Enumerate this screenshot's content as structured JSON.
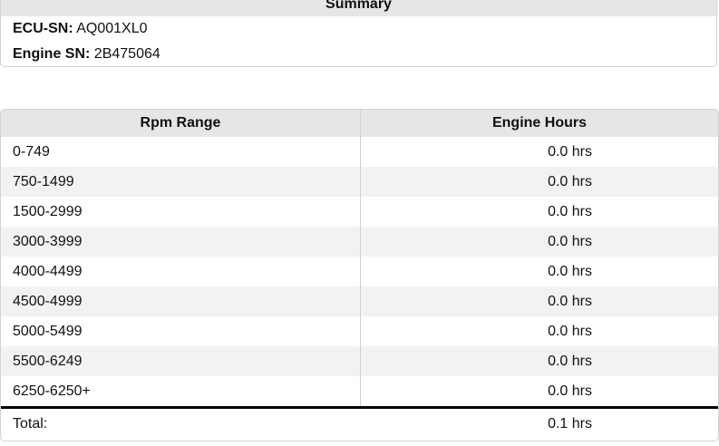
{
  "summary": {
    "title": "Summary",
    "ecu_sn_label": "ECU-SN:",
    "ecu_sn_value": "AQ001XL0",
    "engine_sn_label": "Engine SN:",
    "engine_sn_value": "2B475064"
  },
  "table": {
    "headers": [
      "Rpm Range",
      "Engine Hours"
    ],
    "rows": [
      {
        "range": "0-749",
        "hours": "0.0 hrs"
      },
      {
        "range": "750-1499",
        "hours": "0.0 hrs"
      },
      {
        "range": "1500-2999",
        "hours": "0.0 hrs"
      },
      {
        "range": "3000-3999",
        "hours": "0.0 hrs"
      },
      {
        "range": "4000-4499",
        "hours": "0.0 hrs"
      },
      {
        "range": "4500-4999",
        "hours": "0.0 hrs"
      },
      {
        "range": "5000-5499",
        "hours": "0.0 hrs"
      },
      {
        "range": "5500-6249",
        "hours": "0.0 hrs"
      },
      {
        "range": "6250-6250+",
        "hours": "0.0 hrs"
      }
    ],
    "total_label": "Total:",
    "total_value": "0.1 hrs"
  }
}
